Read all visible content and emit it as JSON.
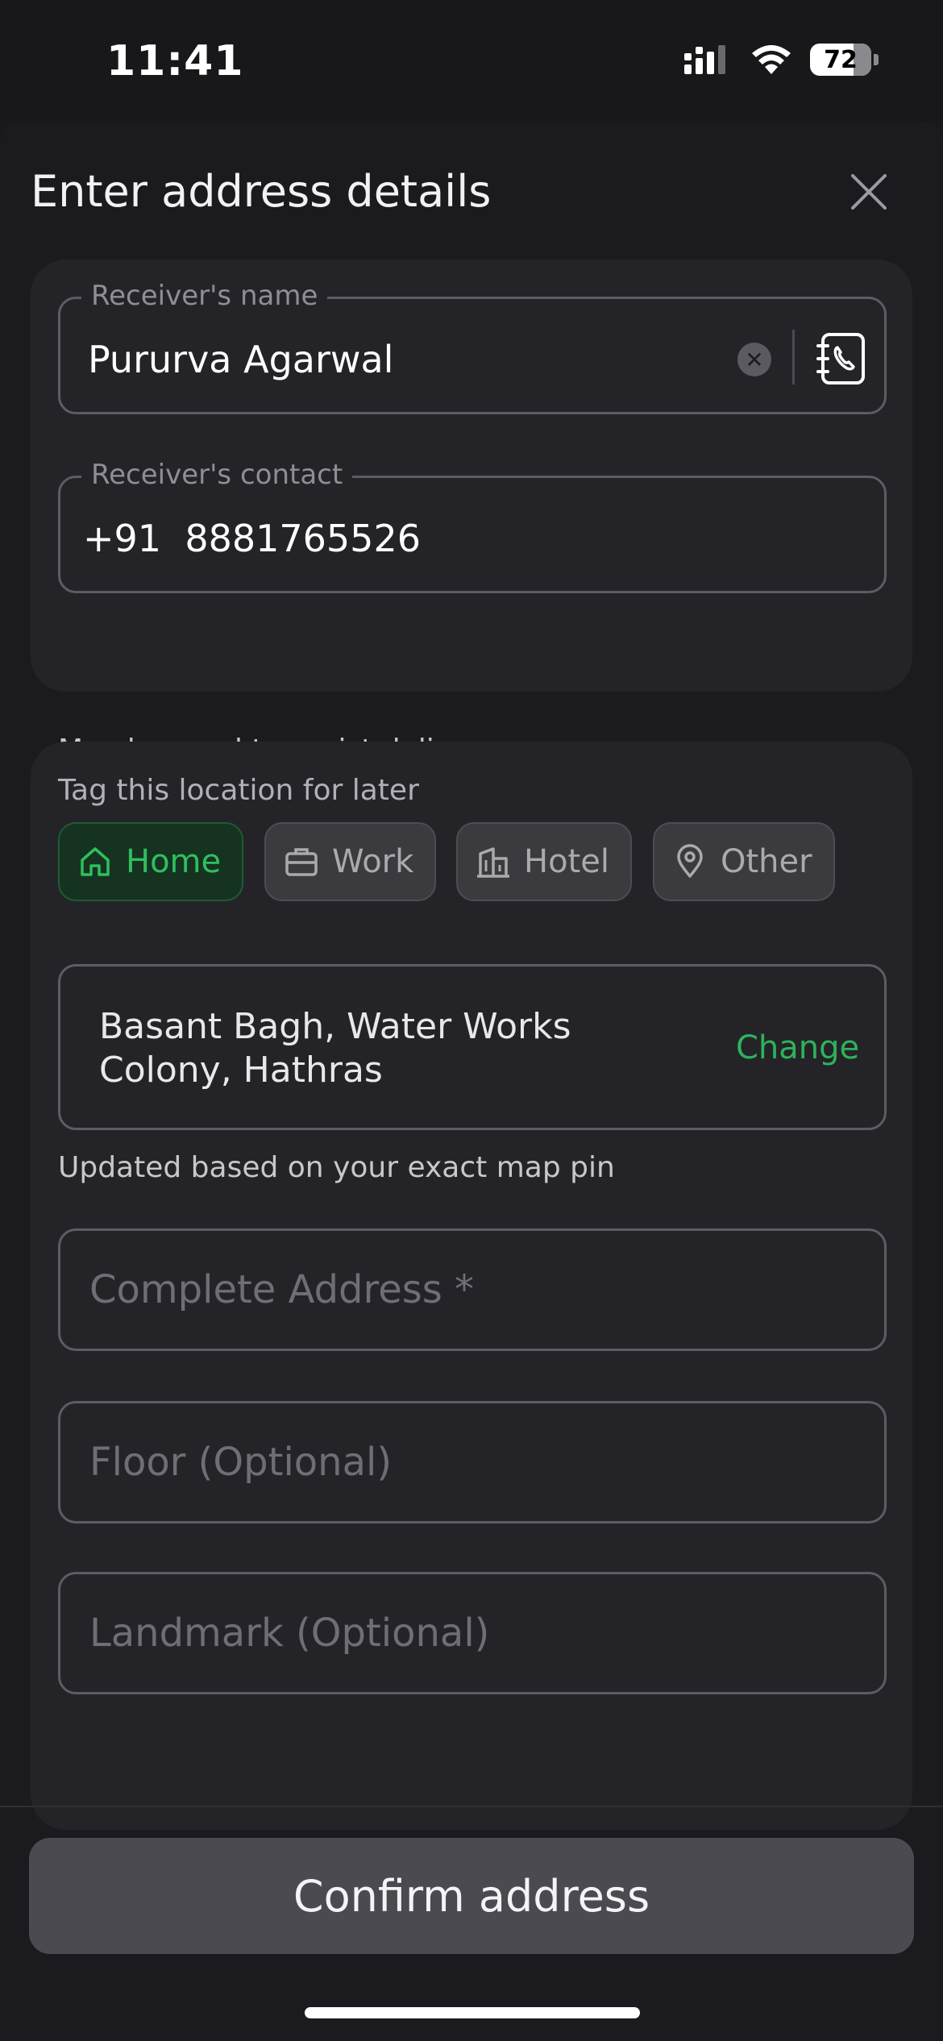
{
  "status_bar": {
    "time": "11:41",
    "battery": "72"
  },
  "sheet": {
    "title": "Enter address details"
  },
  "receiver": {
    "name_label": "Receiver's name",
    "name_value": "Pururva Agarwal",
    "contact_label": "Receiver's contact",
    "contact_value": "+91  8881765526",
    "helper": "May be used to assist delivery"
  },
  "tags": {
    "label": "Tag this location for later",
    "items": [
      {
        "label": "Home",
        "icon": "home-icon",
        "selected": true
      },
      {
        "label": "Work",
        "icon": "briefcase-icon",
        "selected": false
      },
      {
        "label": "Hotel",
        "icon": "building-icon",
        "selected": false
      },
      {
        "label": "Other",
        "icon": "location-pin-icon",
        "selected": false
      }
    ]
  },
  "location": {
    "address": "Basant Bagh, Water Works Colony, Hathras",
    "change_label": "Change",
    "helper": "Updated based on your exact map pin"
  },
  "fields": {
    "complete_address_placeholder": "Complete Address *",
    "floor_placeholder": "Floor (Optional)",
    "landmark_placeholder": "Landmark (Optional)"
  },
  "footer": {
    "confirm_label": "Confirm address"
  },
  "colors": {
    "accent_green": "#2db35a",
    "background": "#1b1b1f",
    "card": "#242428",
    "button": "#4a4a50"
  }
}
